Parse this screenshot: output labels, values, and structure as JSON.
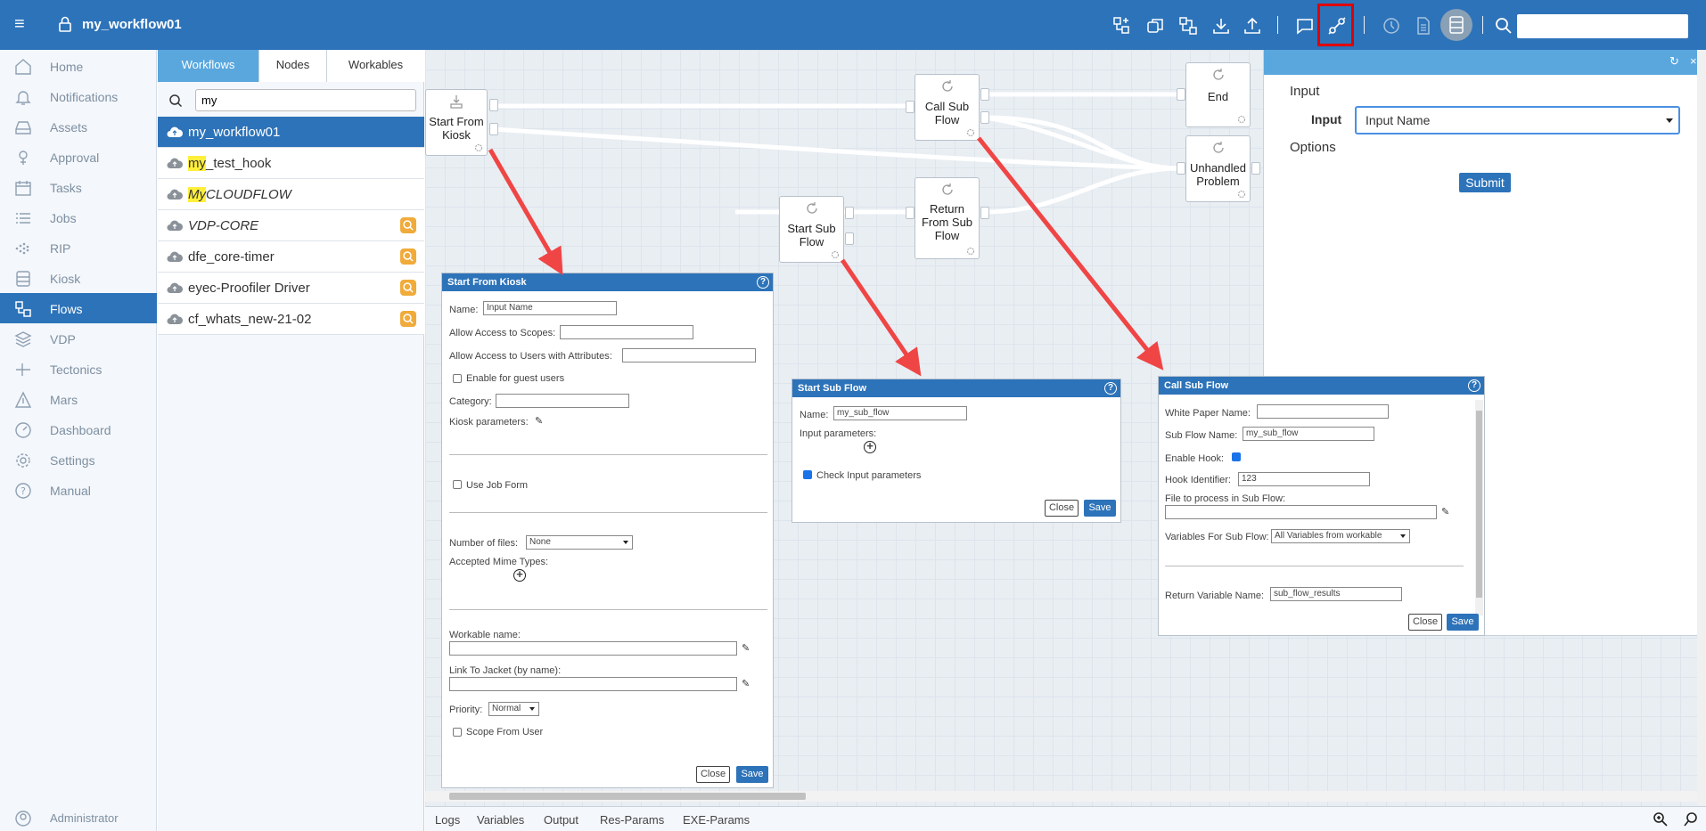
{
  "app": {
    "title": "my_workflow01"
  },
  "colors": {
    "brand": "#2d73b9",
    "highlight_box": "#e00000",
    "arrow": "#f04545"
  },
  "toolbar_icons": [
    "add-node-icon",
    "copy-icon",
    "tree-icon",
    "download-icon",
    "upload-icon",
    "comment-icon",
    "link-icon",
    "history-icon",
    "document-icon",
    "database-icon",
    "search-icon"
  ],
  "sidebar": {
    "items": [
      {
        "label": "Home",
        "icon": "home-icon"
      },
      {
        "label": "Notifications",
        "icon": "bell-icon"
      },
      {
        "label": "Assets",
        "icon": "hdd-icon"
      },
      {
        "label": "Approval",
        "icon": "approval-icon"
      },
      {
        "label": "Tasks",
        "icon": "calendar-icon"
      },
      {
        "label": "Jobs",
        "icon": "list-icon"
      },
      {
        "label": "RIP",
        "icon": "dots-icon"
      },
      {
        "label": "Kiosk",
        "icon": "kiosk-icon"
      },
      {
        "label": "Flows",
        "icon": "flows-icon",
        "active": true
      },
      {
        "label": "VDP",
        "icon": "layers-icon"
      },
      {
        "label": "Tectonics",
        "icon": "tectonics-icon"
      },
      {
        "label": "Mars",
        "icon": "mars-icon"
      },
      {
        "label": "Dashboard",
        "icon": "gauge-icon"
      },
      {
        "label": "Settings",
        "icon": "gear-icon"
      },
      {
        "label": "Manual",
        "icon": "help-icon"
      }
    ],
    "user": "Administrator"
  },
  "panel": {
    "tabs": [
      "Workflows",
      "Nodes",
      "Workables"
    ],
    "search_value": "my",
    "rows": [
      {
        "hl": "",
        "rest": "my_workflow01",
        "italic": false,
        "badge": false,
        "active": true
      },
      {
        "hl": "my",
        "rest": "_test_hook",
        "italic": false,
        "badge": false
      },
      {
        "hl": "My",
        "rest": "CLOUDFLOW",
        "italic": true,
        "badge": false
      },
      {
        "hl": "",
        "rest": "VDP-CORE",
        "italic": true,
        "badge": true
      },
      {
        "hl": "",
        "rest": "dfe_core-timer",
        "italic": false,
        "badge": true
      },
      {
        "hl": "",
        "rest": "eyec-Proofiler Driver",
        "italic": false,
        "badge": true
      },
      {
        "hl": "",
        "rest": "cf_whats_new-21-02",
        "italic": false,
        "badge": true
      }
    ]
  },
  "nodes": {
    "start_kiosk": "Start From Kiosk",
    "call_sub": "Call Sub Flow",
    "end": "End",
    "unhandled": "Unhandled Problem",
    "start_sub": "Start Sub Flow",
    "return_sub": "Return From Sub Flow"
  },
  "dlg_kiosk": {
    "title": "Start From Kiosk",
    "name_label": "Name:",
    "name_value": "Input Name",
    "scopes_label": "Allow Access to Scopes:",
    "users_label": "Allow Access to Users with Attributes:",
    "guest_label": "Enable for guest users",
    "category_label": "Category:",
    "kiosk_params_label": "Kiosk parameters:",
    "job_form_label": "Use Job Form",
    "files_label": "Number of files:",
    "files_value": "None",
    "mime_label": "Accepted Mime Types:",
    "workable_label": "Workable name:",
    "jacket_label": "Link To Jacket (by name):",
    "priority_label": "Priority:",
    "priority_value": "Normal",
    "scope_user_label": "Scope From User",
    "close": "Close",
    "save": "Save"
  },
  "dlg_startsub": {
    "title": "Start Sub Flow",
    "name_label": "Name:",
    "name_value": "my_sub_flow",
    "input_params_label": "Input parameters:",
    "check_label": "Check Input parameters",
    "close": "Close",
    "save": "Save"
  },
  "dlg_callsub": {
    "title": "Call Sub Flow",
    "wp_label": "White Paper Name:",
    "sub_label": "Sub Flow Name:",
    "sub_value": "my_sub_flow",
    "hook_label": "Enable Hook:",
    "hookid_label": "Hook Identifier:",
    "hookid_value": "123",
    "file_label": "File to process in Sub Flow:",
    "vars_label": "Variables For Sub Flow:",
    "vars_value": "All Variables from workable",
    "return_label": "Return Variable Name:",
    "return_value": "sub_flow_results",
    "close": "Close",
    "save": "Save"
  },
  "rpanel": {
    "input_heading": "Input",
    "input_label": "Input",
    "input_value": "Input Name",
    "options_heading": "Options",
    "submit": "Submit"
  },
  "bottom": {
    "tabs": [
      "Logs",
      "Variables",
      "Output",
      "Res-Params",
      "EXE-Params"
    ]
  }
}
